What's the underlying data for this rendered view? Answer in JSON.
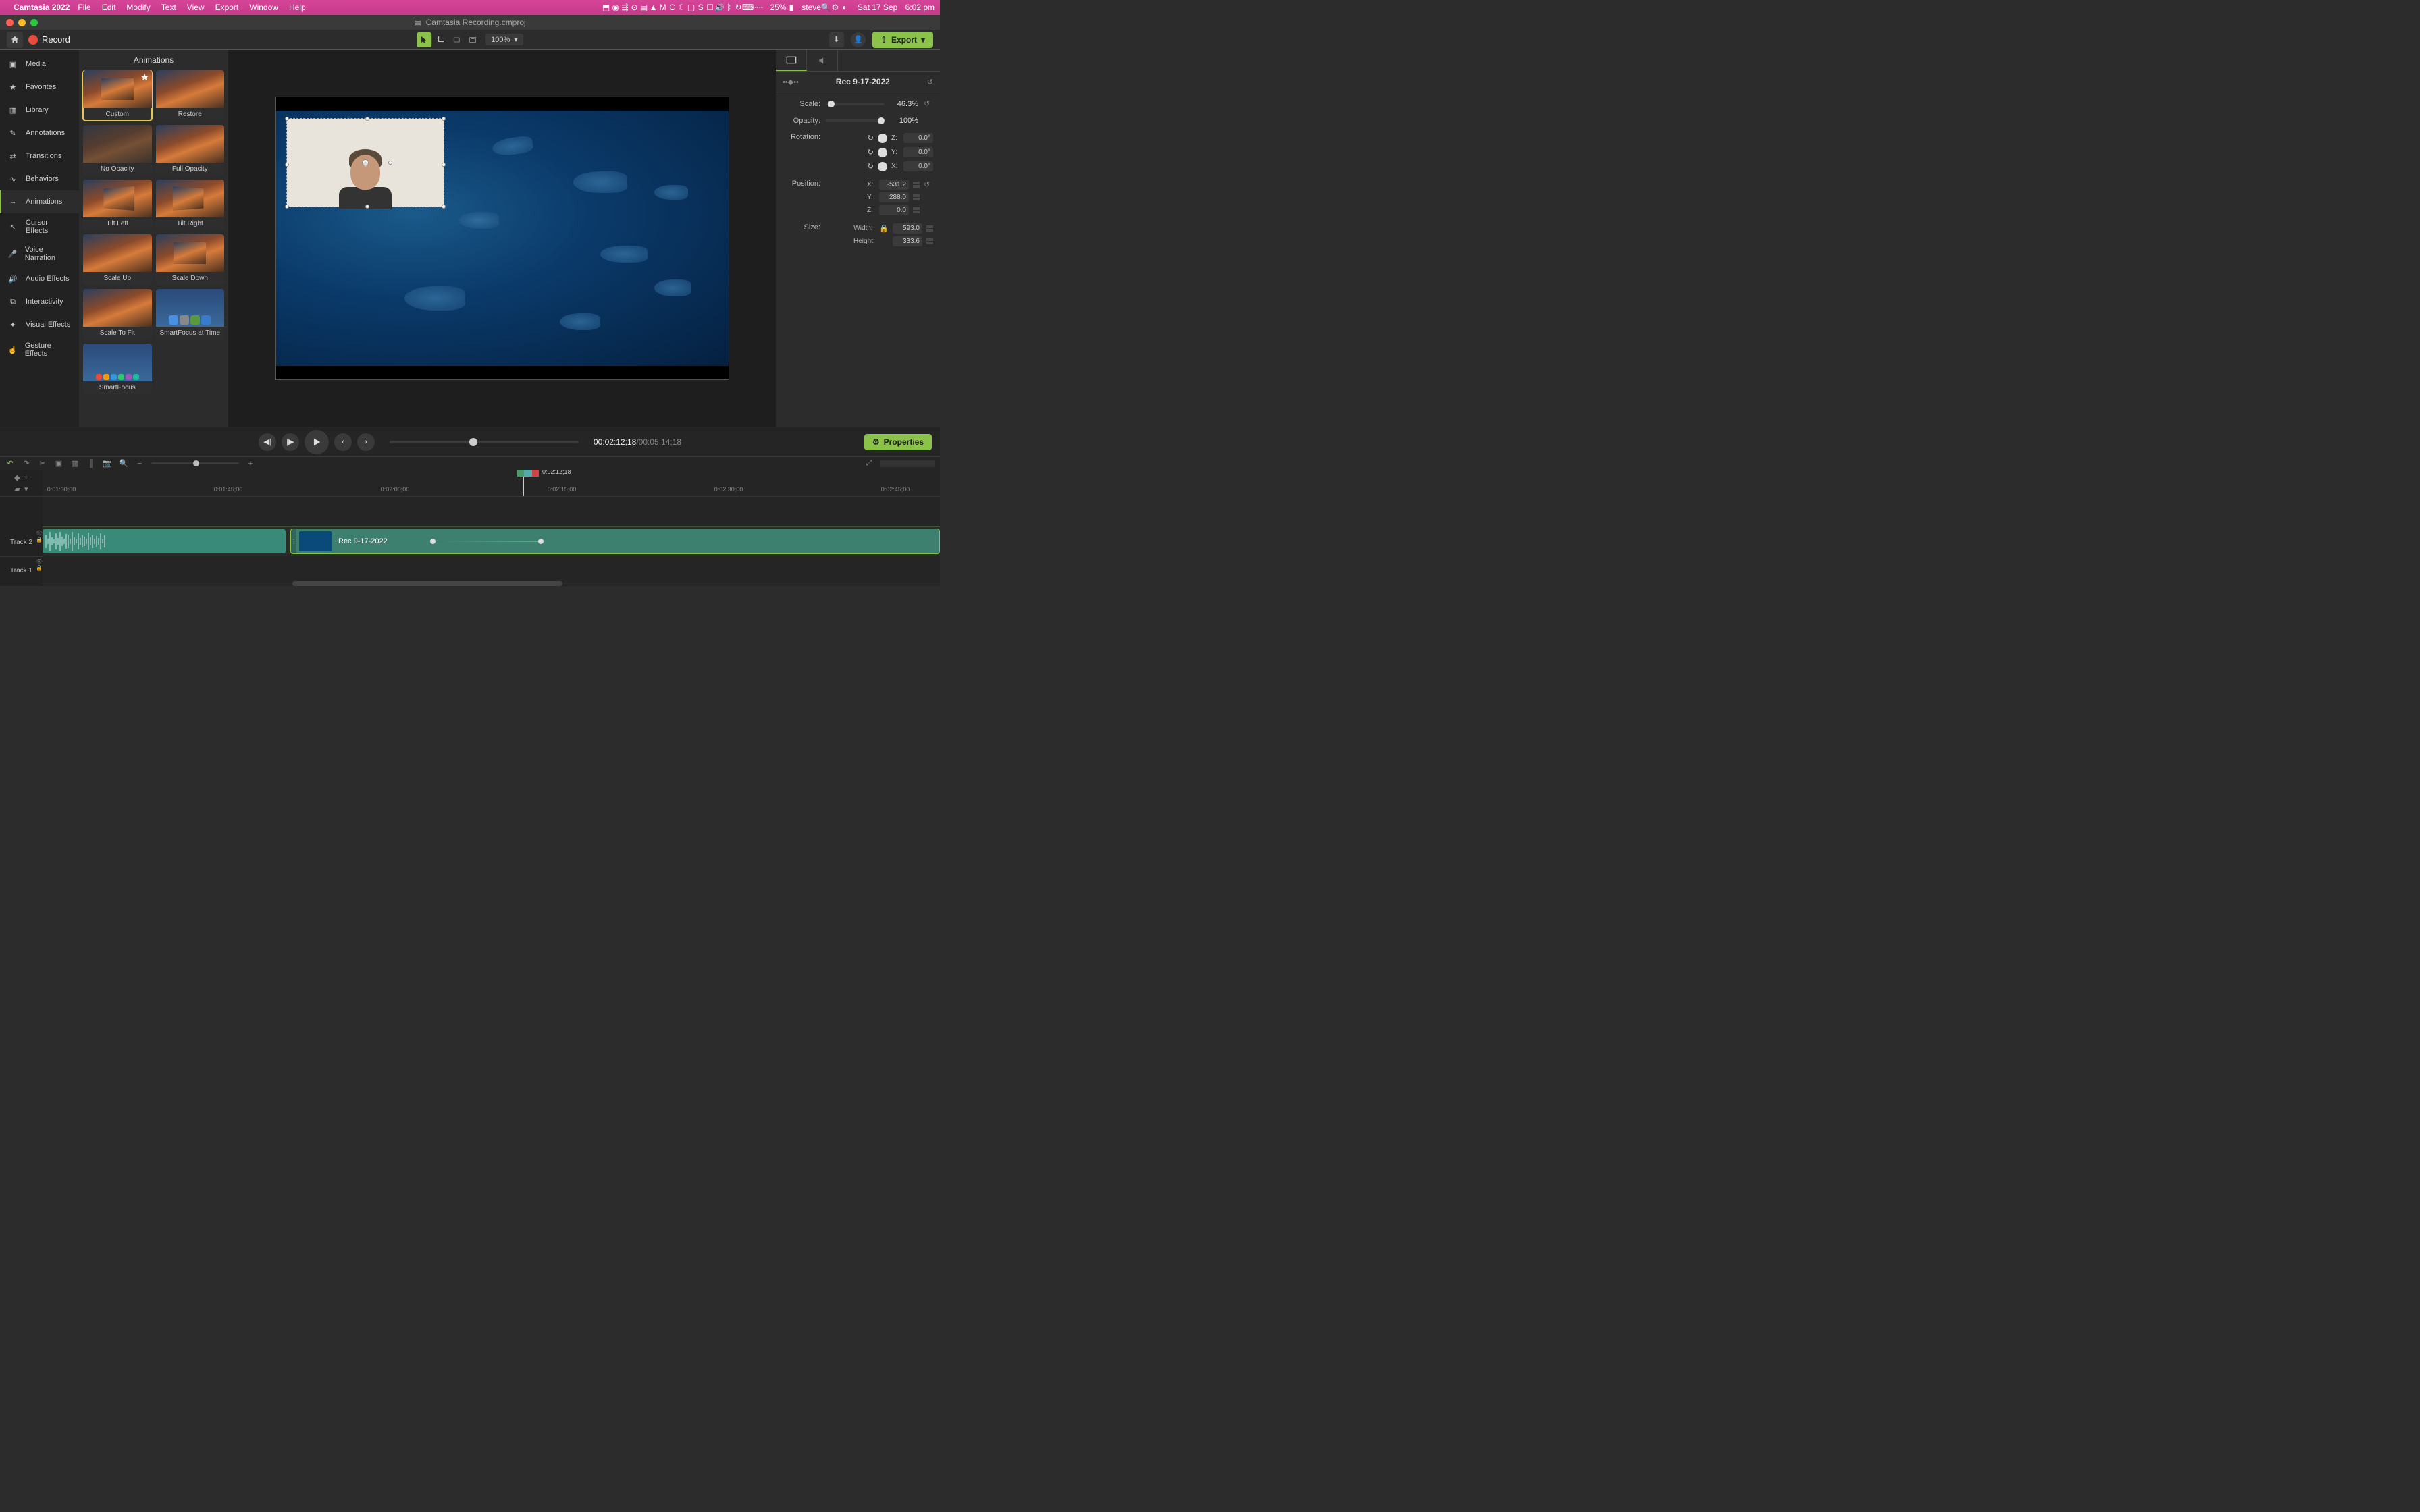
{
  "menubar": {
    "app": "Camtasia 2022",
    "items": [
      "File",
      "Edit",
      "Modify",
      "Text",
      "View",
      "Export",
      "Window",
      "Help"
    ],
    "battery": "25%",
    "user": "steve",
    "date": "Sat 17 Sep",
    "time": "6:02 pm"
  },
  "window": {
    "title": "Camtasia Recording.cmproj"
  },
  "toolbar": {
    "record": "Record",
    "zoom": "100%",
    "export": "Export"
  },
  "rail": [
    "Media",
    "Favorites",
    "Library",
    "Annotations",
    "Transitions",
    "Behaviors",
    "Animations",
    "Cursor Effects",
    "Voice Narration",
    "Audio Effects",
    "Interactivity",
    "Visual Effects",
    "Gesture Effects"
  ],
  "rail_active": 6,
  "panel": {
    "title": "Animations",
    "items": [
      "Custom",
      "Restore",
      "No Opacity",
      "Full Opacity",
      "Tilt Left",
      "Tilt Right",
      "Scale Up",
      "Scale Down",
      "Scale To Fit",
      "SmartFocus at Time",
      "SmartFocus"
    ]
  },
  "props": {
    "name": "Rec 9-17-2022",
    "scale": {
      "label": "Scale:",
      "value": "46.3%",
      "pct": 46
    },
    "opacity": {
      "label": "Opacity:",
      "value": "100%",
      "pct": 100
    },
    "rotation": {
      "label": "Rotation:",
      "z": "0.0°",
      "y": "0.0°",
      "x": "0.0°"
    },
    "position": {
      "label": "Position:",
      "x": "-531.2",
      "y": "288.0",
      "z": "0.0"
    },
    "size": {
      "label": "Size:",
      "w_label": "Width:",
      "w": "593.0",
      "h_label": "Height:",
      "h": "333.6"
    }
  },
  "playback": {
    "current": "00:02:12;18",
    "total": "00:05:14;18",
    "properties": "Properties"
  },
  "timeline": {
    "playhead": "0:02:12;18",
    "ticks": [
      "0:01:30;00",
      "0:01:45;00",
      "0:02:00;00",
      "0:02:15;00",
      "0:02:30;00",
      "0:02:45;00"
    ],
    "tracks": [
      "Track 2",
      "Track 1"
    ],
    "clip_name": "Rec 9-17-2022"
  }
}
